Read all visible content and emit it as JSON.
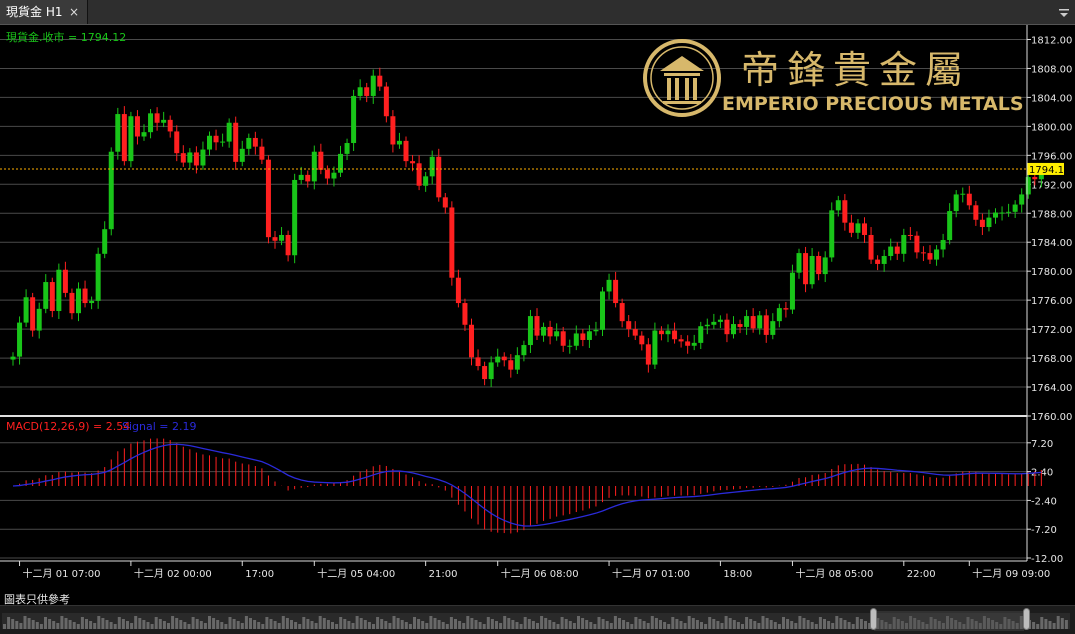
{
  "tab": {
    "title": "現貨金 H1",
    "close": "×"
  },
  "logo": {
    "chinese": "帝鋒貴金屬",
    "english": "EMPERIO PRECIOUS METALS"
  },
  "disclaimer": "圖表只供參考",
  "colors": {
    "up": "#19c519",
    "down": "#ff2020",
    "macd_hist": "#ff2020",
    "signal": "#2a2ad9",
    "grid": "#4a4a4a",
    "axis_text": "#e6e6e6",
    "price_line": "#ffb000",
    "price_label_bg": "#ffee00",
    "separator": "#e0e0e0",
    "legend_green": "#19c519",
    "legend_red": "#ff2020",
    "logo_gold": "#d7b86b"
  },
  "chart_data": [
    {
      "type": "candlestick",
      "title": "現貨金.收市 = 1794.12",
      "current_price": 1794.12,
      "current_price_label": "1794.12",
      "ylim": [
        1760,
        1814
      ],
      "y_ticks": [
        "1812.00",
        "1808.00",
        "1804.00",
        "1800.00",
        "1796.00",
        "1792.00",
        "1788.00",
        "1784.00",
        "1780.00",
        "1776.00",
        "1772.00",
        "1768.00",
        "1764.00",
        "1760.00"
      ],
      "x_ticks": [
        {
          "label": "十二月 01 07:00",
          "index": 1
        },
        {
          "label": "十二月 02 00:00",
          "index": 18
        },
        {
          "label": "17:00",
          "index": 35
        },
        {
          "label": "十二月 05 04:00",
          "index": 46
        },
        {
          "label": "21:00",
          "index": 63
        },
        {
          "label": "十二月 06 08:00",
          "index": 74
        },
        {
          "label": "十二月 07 01:00",
          "index": 91
        },
        {
          "label": "18:00",
          "index": 108
        },
        {
          "label": "十二月 08 05:00",
          "index": 119
        },
        {
          "label": "22:00",
          "index": 136
        },
        {
          "label": "十二月 09 09:00",
          "index": 146
        }
      ],
      "close": [
        1768.2,
        1772.9,
        1776.4,
        1771.8,
        1774.8,
        1778.5,
        1774.5,
        1780.2,
        1777.0,
        1774.2,
        1777.6,
        1775.6,
        1775.9,
        1782.4,
        1785.8,
        1796.5,
        1801.7,
        1795.2,
        1801.4,
        1798.6,
        1799.2,
        1801.8,
        1800.5,
        1800.9,
        1799.3,
        1796.3,
        1795.0,
        1796.4,
        1794.6,
        1796.8,
        1798.7,
        1797.8,
        1797.9,
        1800.5,
        1795.1,
        1796.9,
        1798.4,
        1797.2,
        1795.4,
        1784.7,
        1784.2,
        1785.0,
        1782.2,
        1792.6,
        1793.3,
        1792.4,
        1796.5,
        1794.0,
        1792.8,
        1793.6,
        1796.2,
        1797.7,
        1804.2,
        1805.4,
        1804.2,
        1807.0,
        1805.5,
        1801.4,
        1797.5,
        1798.0,
        1795.2,
        1794.9,
        1791.8,
        1793.1,
        1795.8,
        1790.2,
        1788.8,
        1779.1,
        1775.6,
        1772.6,
        1768.1,
        1766.9,
        1765.1,
        1767.4,
        1768.2,
        1767.7,
        1766.4,
        1768.4,
        1769.8,
        1773.8,
        1771.1,
        1772.3,
        1771.0,
        1771.7,
        1769.7,
        1769.7,
        1771.4,
        1770.5,
        1771.7,
        1771.9,
        1777.2,
        1778.8,
        1775.6,
        1773.1,
        1772.0,
        1771.1,
        1769.9,
        1767.1,
        1771.8,
        1771.3,
        1771.8,
        1770.6,
        1770.3,
        1769.7,
        1770.1,
        1772.4,
        1772.6,
        1773.0,
        1773.3,
        1771.3,
        1772.7,
        1772.3,
        1773.8,
        1772.1,
        1773.9,
        1771.2,
        1773.1,
        1774.9,
        1774.7,
        1779.8,
        1782.5,
        1778.2,
        1782.1,
        1779.6,
        1781.9,
        1788.4,
        1789.8,
        1786.7,
        1785.3,
        1786.6,
        1785.0,
        1781.6,
        1781.0,
        1782.1,
        1783.4,
        1782.4,
        1785.0,
        1784.9,
        1782.6,
        1782.5,
        1781.6,
        1783.0,
        1784.3,
        1788.3,
        1790.6,
        1790.7,
        1789.1,
        1787.1,
        1786.1,
        1787.4,
        1788.1,
        1788.1,
        1788.2,
        1789.2,
        1790.6,
        1793.0,
        1792.7,
        1794.1
      ],
      "macd_title": "MACD(12,26,9) = 2.54",
      "signal_title": "Signal = 2.19",
      "macd_ylim": [
        -12.5,
        11.5
      ],
      "macd_y_ticks": [
        "7.20",
        "2.40",
        "-2.40",
        "-7.20",
        "-12.00"
      ],
      "macd_y_values": [
        7.2,
        2.4,
        -2.4,
        -7.2,
        -12
      ]
    }
  ]
}
